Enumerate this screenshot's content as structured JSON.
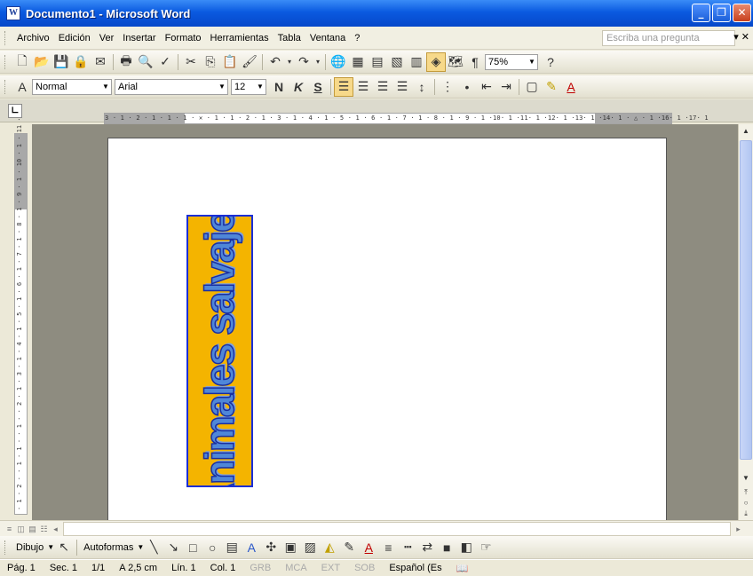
{
  "window": {
    "title": "Documento1 - Microsoft Word"
  },
  "menu": {
    "items": [
      {
        "label": "Archivo"
      },
      {
        "label": "Edición"
      },
      {
        "label": "Ver"
      },
      {
        "label": "Insertar"
      },
      {
        "label": "Formato"
      },
      {
        "label": "Herramientas"
      },
      {
        "label": "Tabla"
      },
      {
        "label": "Ventana"
      },
      {
        "label": "?"
      }
    ],
    "ask_placeholder": "Escriba una pregunta"
  },
  "standard_toolbar": {
    "zoom": "75%"
  },
  "format_toolbar": {
    "style": "Normal",
    "font": "Arial",
    "size": "12",
    "bold_label": "N",
    "italic_label": "K",
    "underline_label": "S"
  },
  "rulers": {
    "horizontal_ticks": "3 · 1 · 2 · 1 · 1 · 1 · ✕ · 1 · 1 · 2 · 1 · 3 · 1 · 4 · 1 · 5 · 1 · 6 · 1 · 7 · 1 · 8 · 1 · 9 · 1 ·10· 1 ·11· 1 ·12· 1 ·13· 1 ·14· 1 · △ · 1 ·16· 1 ·17· 1",
    "vertical_ticks": "· 1 · 2 · · 1 · 1 · · 1 · · 2 · 1 · 3 · 1 · 4 · 1 · 5 · 1 · 6 · 1 · 7 · 1 · 8 · 1 · 9 · 1 · 10 · 1 · 11 ·"
  },
  "document": {
    "wordart_text": "Animales salvajes"
  },
  "drawing_toolbar": {
    "dibujo": "Dibujo",
    "autoformas": "Autoformas"
  },
  "status": {
    "page": "Pág. 1",
    "section": "Sec. 1",
    "pages": "1/1",
    "at": "A 2,5 cm",
    "line": "Lín. 1",
    "col": "Col. 1",
    "grb": "GRB",
    "mca": "MCA",
    "ext": "EXT",
    "sob": "SOB",
    "language": "Español (Es"
  }
}
